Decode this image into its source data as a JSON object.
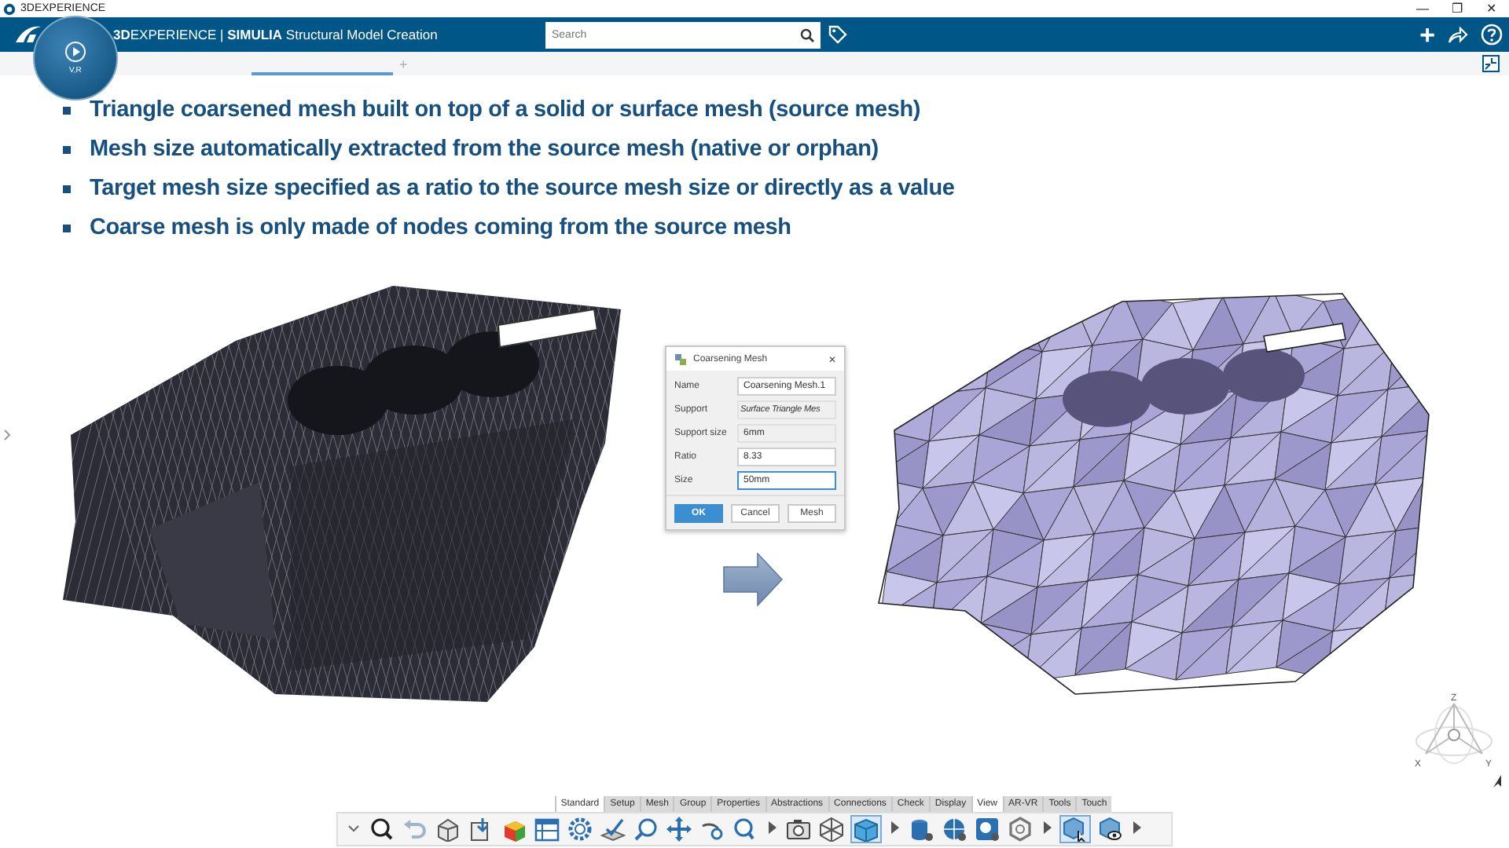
{
  "window": {
    "title": "3DEXPERIENCE",
    "controls": [
      "—",
      "❐",
      "✕"
    ]
  },
  "top_bar": {
    "title": "**3D**EXPERIENCE | **SIMULIA** Structural Model Creation",
    "search": {
      "placeholder": "Search"
    },
    "compass_label": "V,R",
    "actions": [
      "+"
    ]
  },
  "tab_strip": {
    "add": "+"
  },
  "bullets": [
    "Triangle coarsened mesh built on top of a solid or surface mesh (source mesh)",
    "Mesh size automatically extracted from the source mesh (native or orphan)",
    "Target mesh size specified as a ratio to the source mesh size or directly as a value",
    "Coarse mesh is only made of nodes coming from the source mesh"
  ],
  "dialog": {
    "title": "Coarsening Mesh",
    "close": "✕",
    "fields": [
      {
        "label": "Name",
        "value": "Coarsening Mesh.1",
        "kind": "input",
        "focused": false
      },
      {
        "label": "Support",
        "value": "Surface Triangle Mes",
        "kind": "readonly-italic",
        "focused": false
      },
      {
        "label": "Support size",
        "value": "6mm",
        "kind": "readonly",
        "focused": false
      },
      {
        "label": "Ratio",
        "value": "8.33",
        "kind": "input",
        "focused": false
      },
      {
        "label": "Size",
        "value": "50mm",
        "kind": "input",
        "focused": true
      }
    ],
    "buttons": [
      {
        "label": "OK",
        "primary": true
      },
      {
        "label": "Cancel",
        "primary": false
      },
      {
        "label": "Mesh",
        "primary": false
      }
    ]
  },
  "toolbar_tabs": [
    {
      "label": "Standard",
      "selected": true
    },
    {
      "label": "Setup",
      "selected": false
    },
    {
      "label": "Mesh",
      "selected": false
    },
    {
      "label": "Group",
      "selected": false
    },
    {
      "label": "Properties",
      "selected": false
    },
    {
      "label": "Abstractions",
      "selected": false
    },
    {
      "label": "Connections",
      "selected": false
    },
    {
      "label": "Check",
      "selected": false
    },
    {
      "label": "Display",
      "selected": false
    },
    {
      "label": "View",
      "selected": true
    },
    {
      "label": "AR-VR",
      "selected": false
    },
    {
      "label": "Tools",
      "selected": false
    },
    {
      "label": "Touch",
      "selected": false
    }
  ],
  "axes": {
    "z": "Z",
    "x": "X",
    "y": "Y"
  }
}
